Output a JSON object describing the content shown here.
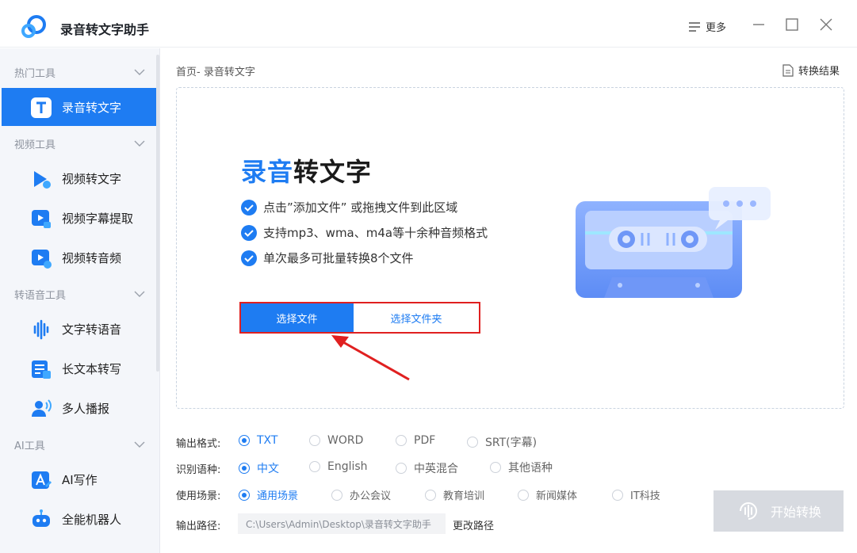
{
  "app": {
    "title": "录音转文字助手",
    "more_label": "更多"
  },
  "sidebar": {
    "sections": [
      {
        "label": "热门工具"
      },
      {
        "label": "视频工具"
      },
      {
        "label": "转语音工具"
      },
      {
        "label": "AI工具"
      }
    ],
    "items": [
      {
        "label": "录音转文字",
        "icon": "text-t-icon",
        "active": true
      },
      {
        "label": "视频转文字",
        "icon": "video-text-icon"
      },
      {
        "label": "视频字幕提取",
        "icon": "subtitle-extract-icon"
      },
      {
        "label": "视频转音频",
        "icon": "video-audio-icon"
      },
      {
        "label": "文字转语音",
        "icon": "waveform-icon"
      },
      {
        "label": "长文本转写",
        "icon": "long-text-icon"
      },
      {
        "label": "多人播报",
        "icon": "multi-speaker-icon"
      },
      {
        "label": "AI写作",
        "icon": "ai-write-icon"
      },
      {
        "label": "全能机器人",
        "icon": "robot-icon"
      }
    ]
  },
  "main": {
    "breadcrumb": "首页- 录音转文字",
    "result_link": "转换结果",
    "hero_title_highlight": "录音",
    "hero_title_rest": "转文字",
    "features": [
      "点击”添加文件” 或拖拽文件到此区域",
      "支持mp3、wma、m4a等十余种音频格式",
      "单次最多可批量转换8个文件"
    ],
    "btn_select_file": "选择文件",
    "btn_select_folder": "选择文件夹"
  },
  "options": {
    "format_label": "输出格式:",
    "format_options": [
      "TXT",
      "WORD",
      "PDF",
      "SRT(字幕)"
    ],
    "format_selected": "TXT",
    "lang_label": "识别语种:",
    "lang_options": [
      "中文",
      "English",
      "中英混合",
      "其他语种"
    ],
    "lang_selected": "中文",
    "scene_label": "使用场景:",
    "scene_options": [
      "通用场景",
      "办公会议",
      "教育培训",
      "新闻媒体",
      "IT科技"
    ],
    "scene_selected": "通用场景",
    "path_label": "输出路径:",
    "path_value": "C:\\Users\\Admin\\Desktop\\录音转文字助手",
    "change_path": "更改路径"
  },
  "start_button": "开始转换",
  "colors": {
    "accent": "#1e7cf2",
    "highlight_border": "#e02020",
    "disabled": "#d7dae0"
  }
}
